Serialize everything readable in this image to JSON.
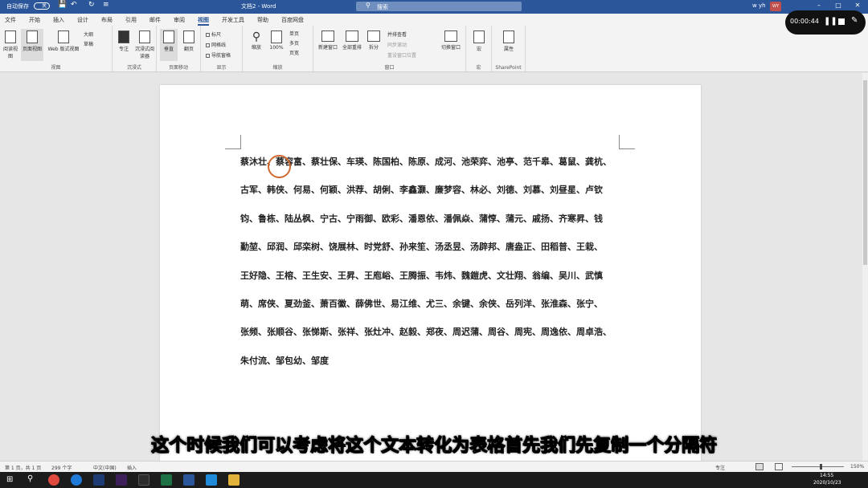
{
  "titlebar": {
    "autosave": "自动保存",
    "autosave_state": "关",
    "doc_title": "文档2 - Word",
    "search_placeholder": "搜索",
    "user": "w yh",
    "user_initials": "WY"
  },
  "tabs": [
    "文件",
    "开始",
    "插入",
    "设计",
    "布局",
    "引用",
    "邮件",
    "审阅",
    "视图",
    "开发工具",
    "帮助",
    "百度网盘"
  ],
  "active_tab": "视图",
  "ribbon": {
    "views": {
      "buttons": [
        "阅读视图",
        "页面视图",
        "Web 版式视图"
      ],
      "small": [
        "大纲",
        "草稿"
      ],
      "label": "视图"
    },
    "immersive": {
      "buttons": [
        "专注",
        "沉浸式阅读器"
      ],
      "label": "沉浸式"
    },
    "page_move": {
      "buttons": [
        "垂直",
        "翻页"
      ],
      "label": "页面移动"
    },
    "show": {
      "checks": [
        "标尺",
        "网格线",
        "导航窗格"
      ],
      "label": "显示"
    },
    "zoom": {
      "buttons": [
        "缩放",
        "100%"
      ],
      "small": [
        "单页",
        "多页",
        "页宽"
      ],
      "label": "缩放"
    },
    "window": {
      "buttons": [
        "新建窗口",
        "全部重排",
        "拆分"
      ],
      "small": [
        "并排查看",
        "同步滚动",
        "重设窗口位置"
      ],
      "switch": "切换窗口",
      "label": "窗口"
    },
    "macros": {
      "button": "宏",
      "label": "宏"
    },
    "sharepoint": {
      "button": "属性",
      "label": "SharePoint"
    }
  },
  "document": {
    "lines": [
      "蔡沐壮、蔡容富、蔡壮保、车瑛、陈国柏、陈原、成河、池荣弈、池亭、范千皋、葛鼠、龚杭、",
      "古军、韩侠、何易、何颖、洪荐、胡俐、李鑫灏、廉梦容、林必、刘德、刘慕、刘昼星、卢钦",
      "钧、鲁栋、陆丛枫、宁古、宁雨御、欧彩、潘恩依、潘佩焱、蒲惇、蒲元、戚扬、齐寒昇、钱",
      "勤堃、邱润、邱栾树、饶展林、时党舒、孙来笙、汤丞昱、汤辟邦、唐盎正、田稻普、王栽、",
      "王好隐、王榕、王生安、王昇、王庖峪、王腾振、韦炜、魏鎧虎、文壮翔、翁编、吴川、武慎",
      "萌、席侠、夏劲釜、萧百徽、薛佛世、易江维、尤三、余键、余侠、岳列洋、张淮森、张宁、",
      "张频、张顺谷、张悌斯、张祥、张灶冲、赵毅、郑夜、周迟蒲、周谷、周宪、周逸依、周卓浩、",
      "朱付流、邹包幼、邹度"
    ]
  },
  "subtitle": "这个时候我们可以考虑将这个文本转化为表格首先我们先复制一个分隔符",
  "statusbar": {
    "page": "第 1 页，共 1 页",
    "words": "299 个字",
    "lang": "中文(中国)",
    "mode": "插入",
    "focus": "专注",
    "zoom": "150%"
  },
  "taskbar": {
    "time": "14:55",
    "date": "2020/10/23"
  },
  "recorder": {
    "time": "00:00:44"
  }
}
